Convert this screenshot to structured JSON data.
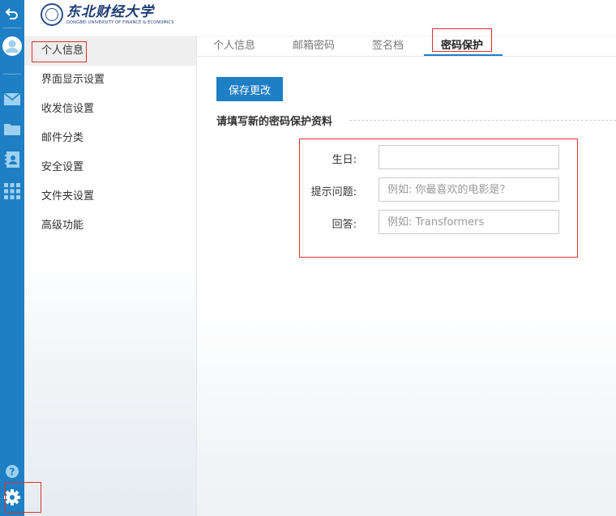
{
  "header": {
    "logo_cn": "东北财经大学",
    "logo_en": "DONGBEI UNIVERSITY OF FINANCE & ECONOMICS"
  },
  "rail": {
    "icons": [
      "back-icon",
      "avatar-icon",
      "mail-icon",
      "folder-icon",
      "contacts-icon",
      "apps-icon",
      "help-icon",
      "gear-icon"
    ]
  },
  "nav": {
    "items": [
      {
        "label": "个人信息"
      },
      {
        "label": "界面显示设置"
      },
      {
        "label": "收发信设置"
      },
      {
        "label": "邮件分类"
      },
      {
        "label": "安全设置"
      },
      {
        "label": "文件夹设置"
      },
      {
        "label": "高级功能"
      }
    ]
  },
  "tabs": [
    {
      "label": "个人信息"
    },
    {
      "label": "邮箱密码"
    },
    {
      "label": "签名档"
    },
    {
      "label": "密码保护"
    }
  ],
  "main": {
    "save_label": "保存更改",
    "section_title": "请填写新的密码保护资料",
    "form": {
      "birthday_label": "生日:",
      "birthday_value": "",
      "question_label": "提示问题:",
      "question_placeholder": "例如: 你最喜欢的电影是？",
      "answer_label": "回答:",
      "answer_placeholder": "例如: Transformers"
    }
  },
  "colors": {
    "accent": "#1e7fc4",
    "highlight_border": "#e0302e"
  }
}
